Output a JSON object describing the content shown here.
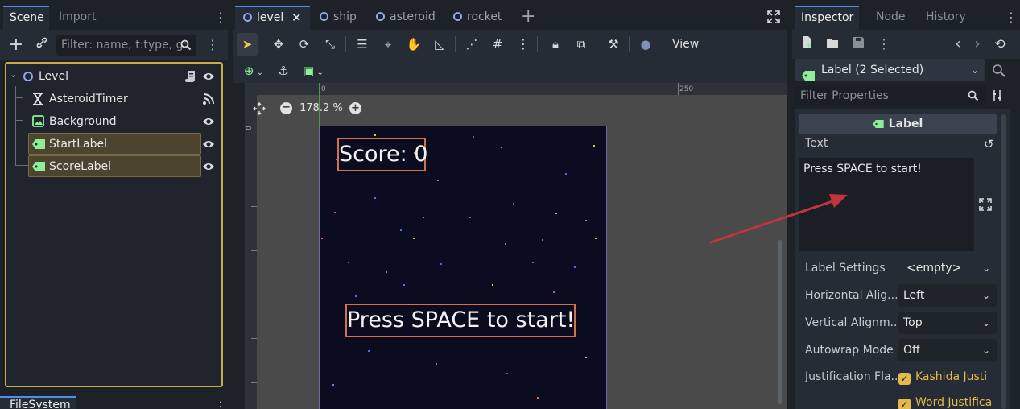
{
  "left_dock": {
    "tabs": [
      {
        "label": "Scene",
        "active": true
      },
      {
        "label": "Import",
        "active": false
      }
    ],
    "filter_placeholder": "Filter: name, t:type, g:",
    "tree": [
      {
        "label": "Level",
        "icon": "node2d-ring-icon",
        "depth": 0,
        "selected": false
      },
      {
        "label": "AsteroidTimer",
        "icon": "timer-icon",
        "depth": 1,
        "selected": false
      },
      {
        "label": "Background",
        "icon": "texture-rect-icon",
        "depth": 1,
        "selected": false
      },
      {
        "label": "StartLabel",
        "icon": "label-icon",
        "depth": 1,
        "selected": true
      },
      {
        "label": "ScoreLabel",
        "icon": "label-icon",
        "depth": 1,
        "selected": true
      }
    ],
    "bottom_tab": "FileSystem"
  },
  "center": {
    "scene_tabs": [
      {
        "label": "level",
        "active": true,
        "closable": true
      },
      {
        "label": "ship",
        "active": false
      },
      {
        "label": "asteroid",
        "active": false
      },
      {
        "label": "rocket",
        "active": false
      }
    ],
    "view_menu": "View",
    "ruler": {
      "zero": "0",
      "mark": "250",
      "left_zero": "0"
    },
    "zoom": "178.2 %",
    "game_labels": {
      "score": "Score: 0",
      "start": "Press SPACE to start!"
    }
  },
  "inspector": {
    "tabs": [
      {
        "label": "Inspector",
        "active": true
      },
      {
        "label": "Node",
        "active": false
      },
      {
        "label": "History",
        "active": false
      }
    ],
    "node_selector": "Label (2 Selected)",
    "filter_placeholder": "Filter Properties",
    "class_header": "Label",
    "text_label": "Text",
    "text_value": "Press SPACE to start!",
    "properties": [
      {
        "label": "Label Settings",
        "value": "<empty>"
      },
      {
        "label": "Horizontal Alig...",
        "value": "Left"
      },
      {
        "label": "Vertical Alignm...",
        "value": "Top"
      },
      {
        "label": "Autowrap Mode",
        "value": "Off"
      }
    ],
    "justification_label": "Justification Fla...",
    "justification_flags": [
      "Kashida Justi",
      "Word Justifica"
    ]
  },
  "colors": {
    "accent": "#4b8ff0",
    "selection_border": "#c9a94a",
    "label_outline": "#d3714a",
    "annotation_arrow": "#c0343c",
    "checkbox": "#e3b94b"
  }
}
